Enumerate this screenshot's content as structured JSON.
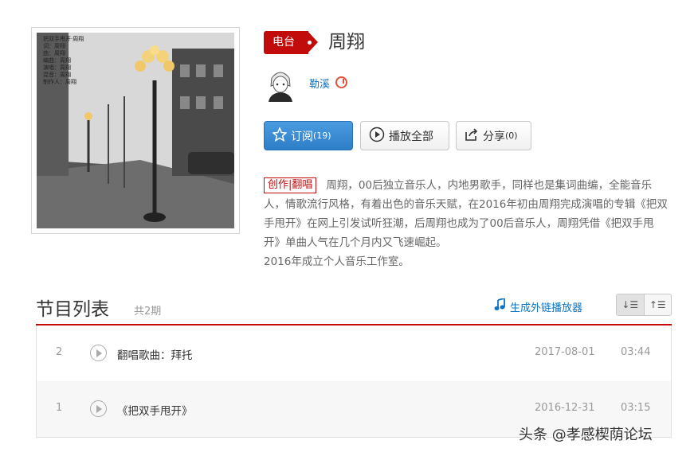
{
  "cover": {
    "overlay_text": "把双手甩开·周翔\n词：周翔\n曲：周翔\n编曲：周翔\n演唱：周翔\n混音：周翔\n制作人：周翔"
  },
  "header": {
    "type_tag": "电台",
    "title": "周翔",
    "author": "勒溪"
  },
  "buttons": {
    "subscribe_label": "订阅",
    "subscribe_count": "(19)",
    "play_all_label": "播放全部",
    "share_label": "分享",
    "share_count": "(0)"
  },
  "description": {
    "category": "创作|翻唱",
    "text": "周翔，00后独立音乐人，内地男歌手，同样也是集词曲编，全能音乐人，情歌流行风格，有着出色的音乐天赋，在2016年初由周翔完成演唱的专辑《把双手甩开》在网上引发试听狂潮，后周翔也成为了00后音乐人，周翔凭借《把双手甩开》单曲人气在几个月内又飞速崛起。",
    "text2": "2016年成立个人音乐工作室。"
  },
  "list": {
    "title": "节目列表",
    "count": "共2期",
    "generate_link": "生成外链播放器",
    "rows": [
      {
        "num": "2",
        "name": "翻唱歌曲：拜托",
        "date": "2017-08-01",
        "duration": "03:44"
      },
      {
        "num": "1",
        "name": "《把双手甩开》",
        "date": "2016-12-31",
        "duration": "03:15"
      }
    ]
  },
  "watermark": "头条 @孝感楔荫论坛",
  "colors": {
    "accent": "#c20c0c",
    "link": "#0c73c2",
    "subscribe": "#2d7ec8"
  }
}
